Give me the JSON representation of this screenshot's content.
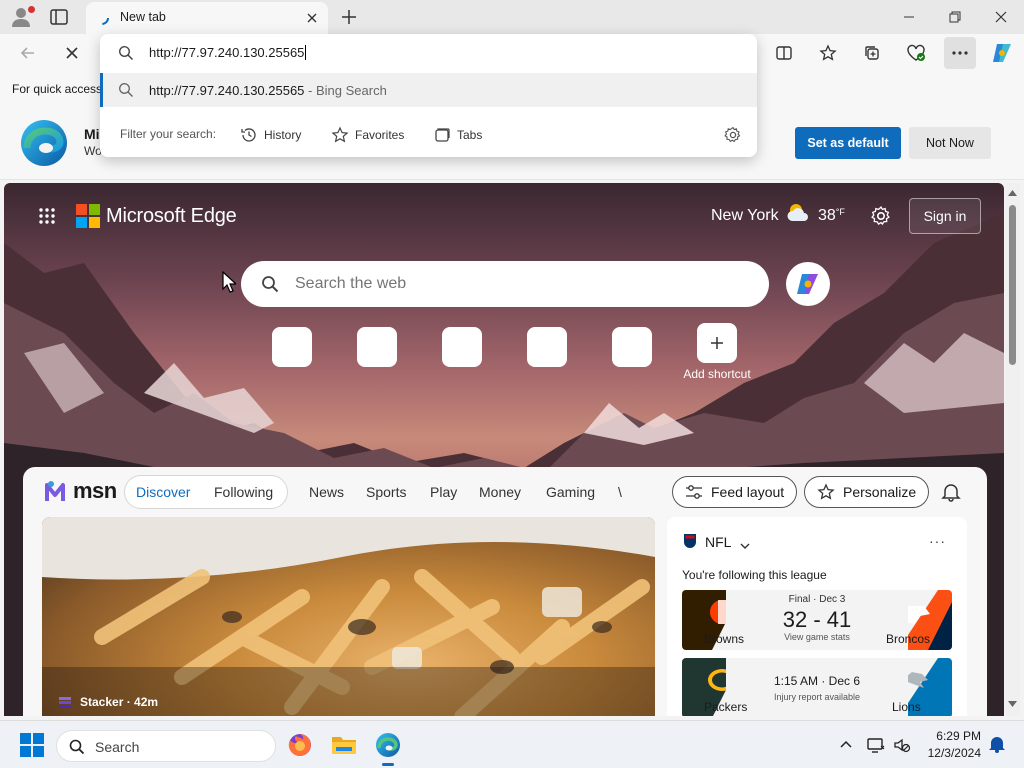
{
  "browser": {
    "tab_title": "New tab",
    "address_value": "http://77.97.240.130.25565",
    "suggestion": {
      "text": "http://77.97.240.130.25565",
      "extra": " - Bing Search"
    },
    "filter_label": "Filter your search:",
    "filters": [
      {
        "label": "History",
        "icon": "history-icon"
      },
      {
        "label": "Favorites",
        "icon": "star-icon"
      },
      {
        "label": "Tabs",
        "icon": "tabs-icon"
      }
    ],
    "favbar_text": "For quick access"
  },
  "promo": {
    "title": "Mi",
    "subtitle": "Wo",
    "set_default_label": "Set as default",
    "not_now_label": "Not Now"
  },
  "ntp": {
    "brand": "Microsoft Edge",
    "city": "New York",
    "temperature": "38",
    "temp_unit": "°F",
    "signin_label": "Sign in",
    "search_placeholder": "Search the web",
    "add_shortcut_label": "Add shortcut"
  },
  "feed": {
    "brand": "msn",
    "tabs": [
      "Discover",
      "Following",
      "News",
      "Sports",
      "Play",
      "Money",
      "Gaming",
      "\\"
    ],
    "feed_layout_label": "Feed layout",
    "personalize_label": "Personalize",
    "hero_source": "Stacker · 42m"
  },
  "nfl": {
    "title": "NFL",
    "following_text": "You're following this league",
    "games": [
      {
        "home": "Browns",
        "away": "Broncos",
        "status": "Final · Dec 3",
        "score": "32 - 41",
        "note": "View game stats"
      },
      {
        "home": "Packers",
        "away": "Lions",
        "status": "",
        "time": "1:15 AM · Dec 6",
        "note": "Injury report available"
      }
    ]
  },
  "taskbar": {
    "search_label": "Search",
    "time": "6:29 PM",
    "date": "12/3/2024"
  },
  "colors": {
    "accent": "#0f6cbd",
    "browns": "#311d00",
    "broncos": "#fb4f14",
    "packers": "#203731",
    "lions": "#0076b6"
  }
}
